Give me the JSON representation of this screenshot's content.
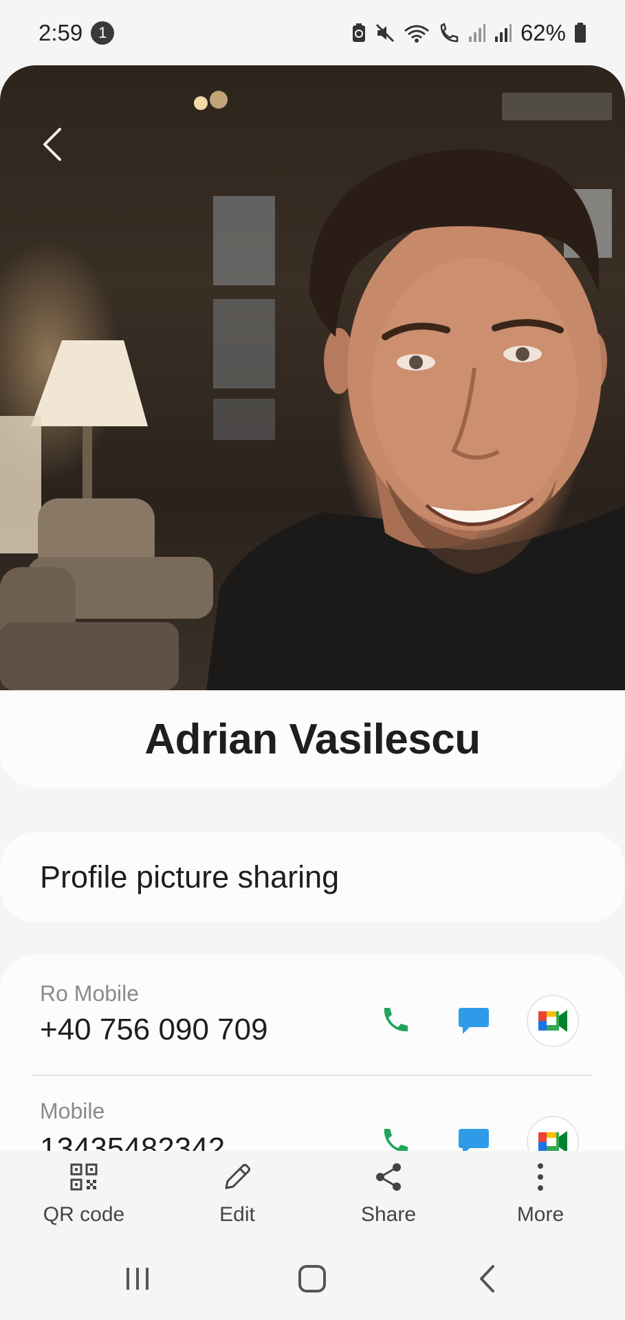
{
  "status_bar": {
    "time": "2:59",
    "notification_count": "1",
    "battery_percent": "62%"
  },
  "contact": {
    "name": "Adrian Vasilescu",
    "photo_description_icon": "contact-photo"
  },
  "profile_sharing": {
    "label": "Profile picture sharing"
  },
  "phones": [
    {
      "type": "Ro Mobile",
      "number": "+40 756 090 709"
    },
    {
      "type": "Mobile",
      "number": "13435482342"
    }
  ],
  "bottom_actions": [
    {
      "label": "QR code",
      "icon": "qr-code-icon"
    },
    {
      "label": "Edit",
      "icon": "pencil-icon"
    },
    {
      "label": "Share",
      "icon": "share-icon"
    },
    {
      "label": "More",
      "icon": "more-vertical-icon"
    }
  ],
  "colors": {
    "call_green": "#1fa55a",
    "message_blue": "#2e9be8",
    "background": "#f5f5f5",
    "card": "#fcfcfc"
  }
}
